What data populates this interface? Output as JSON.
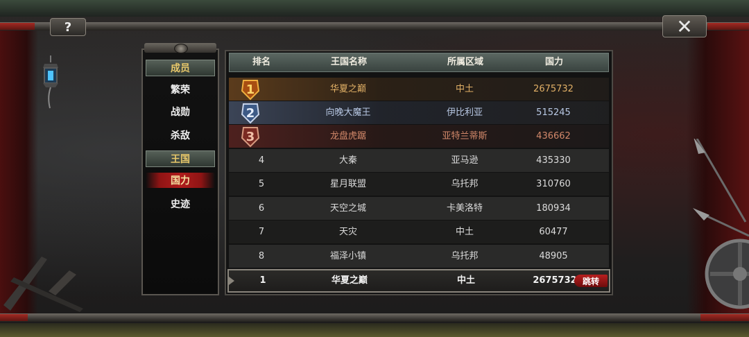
{
  "window": {
    "help_label": "?",
    "close_label": "✕"
  },
  "sidebar": {
    "section_members": "成员",
    "items_members": [
      {
        "label": "繁荣"
      },
      {
        "label": "战勋"
      },
      {
        "label": "杀敌"
      }
    ],
    "section_kingdom": "王国",
    "items_kingdom": [
      {
        "label": "国力",
        "active": true
      },
      {
        "label": "史迹"
      }
    ]
  },
  "table": {
    "columns": [
      "排名",
      "王国名称",
      "所属区域",
      "国力"
    ],
    "rows": [
      {
        "rank": "1",
        "name": "华夏之巅",
        "region": "中土",
        "power": "2675732"
      },
      {
        "rank": "2",
        "name": "向晚大魔王",
        "region": "伊比利亚",
        "power": "515245"
      },
      {
        "rank": "3",
        "name": "龙盘虎踞",
        "region": "亚特兰蒂斯",
        "power": "436662"
      },
      {
        "rank": "4",
        "name": "大秦",
        "region": "亚马逊",
        "power": "435330"
      },
      {
        "rank": "5",
        "name": "星月联盟",
        "region": "乌托邦",
        "power": "310760"
      },
      {
        "rank": "6",
        "name": "天空之城",
        "region": "卡美洛特",
        "power": "180934"
      },
      {
        "rank": "7",
        "name": "天灾",
        "region": "中土",
        "power": "60477"
      },
      {
        "rank": "8",
        "name": "福泽小镇",
        "region": "乌托邦",
        "power": "48905"
      }
    ],
    "my_row": {
      "rank": "1",
      "name": "华夏之巅",
      "region": "中土",
      "power": "2675732",
      "jump_label": "跳转"
    }
  },
  "colors": {
    "gold": "#e1b066",
    "silver_blue": "#b8c8e4",
    "bronze": "#d2886a",
    "active_red": "#b01c1c",
    "header_green": "#566058"
  }
}
